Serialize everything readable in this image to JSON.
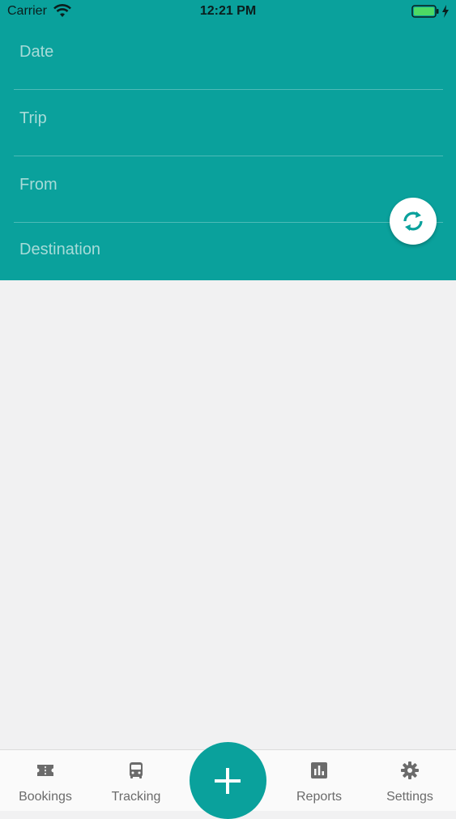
{
  "status_bar": {
    "carrier": "Carrier",
    "time": "12:21 PM",
    "icons": [
      "wifi-icon",
      "battery-icon",
      "charging-bolt-icon"
    ]
  },
  "form": {
    "date_placeholder": "Date",
    "trip_placeholder": "Trip",
    "from_placeholder": "From",
    "destination_placeholder": "Destination",
    "swap_icon": "swap-refresh-icon"
  },
  "tab_bar": {
    "items": [
      {
        "label": "Bookings",
        "icon": "ticket-icon"
      },
      {
        "label": "Tracking",
        "icon": "bus-icon"
      },
      {
        "label": "Reports",
        "icon": "bar-chart-icon"
      },
      {
        "label": "Settings",
        "icon": "gear-icon"
      }
    ],
    "add_icon": "plus-icon"
  },
  "colors": {
    "primary": "#0aa19c",
    "placeholder": "#a7dbd8",
    "background": "#f1f1f2",
    "tab_inactive": "#6b6b6b",
    "battery": "#4cd964"
  }
}
